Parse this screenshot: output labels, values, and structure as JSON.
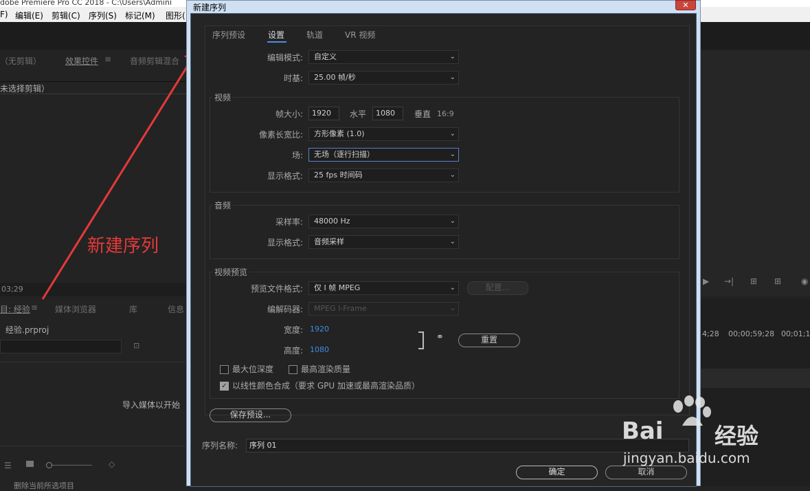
{
  "app": {
    "title": "dobe Premiere Pro CC 2018 - C:\\Users\\Admini",
    "menu": [
      "F)",
      "编辑(E)",
      "剪辑(C)",
      "序列(S)",
      "标记(M)",
      "图形("
    ],
    "left_tabs": [
      "（无剪辑）",
      "效果控件",
      "音频剪辑混合"
    ],
    "no_clip_selected": "未选择剪辑）",
    "timecode": "03;29",
    "project_tabs": [
      "目: 经验",
      "媒体浏览器",
      "库",
      "信息"
    ],
    "project_file": "经验.prproj",
    "import_hint": "导入媒体以开始",
    "delete_hint": "删除当前所选项目",
    "timeline_times": [
      "4;28",
      "00;00;59;28",
      "00;01;14;"
    ]
  },
  "dialog": {
    "title": "新建序列",
    "close_icon": "✕",
    "tabs": [
      {
        "label": "序列预设",
        "active": false
      },
      {
        "label": "设置",
        "active": true
      },
      {
        "label": "轨道",
        "active": false
      },
      {
        "label": "VR 视频",
        "active": false
      }
    ],
    "edit_mode_label": "编辑模式:",
    "edit_mode_value": "自定义",
    "timebase_label": "时基:",
    "timebase_value": "25.00  帧/秒",
    "video": {
      "group_title": "视频",
      "frame_size_label": "帧大小:",
      "width": "1920",
      "horizontal_label": "水平",
      "height": "1080",
      "vertical_label": "垂直",
      "aspect": "16:9",
      "pixel_aspect_label": "像素长宽比:",
      "pixel_aspect_value": "方形像素 (1.0)",
      "field_label": "场:",
      "field_value": "无场（逐行扫描）",
      "display_format_label": "显示格式:",
      "display_format_value": "25 fps 时间码"
    },
    "audio": {
      "group_title": "音频",
      "sample_rate_label": "采样率:",
      "sample_rate_value": "48000 Hz",
      "display_format_label": "显示格式:",
      "display_format_value": "音频采样"
    },
    "preview": {
      "group_title": "视频预览",
      "file_format_label": "预览文件格式:",
      "file_format_value": "仅 I 帧 MPEG",
      "config_button": "配置...",
      "codec_label": "编解码器:",
      "codec_value": "MPEG I-Frame",
      "width_label": "宽度:",
      "width_value": "1920",
      "height_label": "高度:",
      "height_value": "1080",
      "reset_button": "重置",
      "max_bit_depth": "最大位深度",
      "max_render_quality": "最高渲染质量",
      "linear_color": "以线性颜色合成（要求 GPU 加速或最高渲染品质）"
    },
    "save_preset_button": "保存预设...",
    "sequence_name_label": "序列名称:",
    "sequence_name_value": "序列 01",
    "ok_button": "确定",
    "cancel_button": "取消"
  },
  "annotation_text": "新建序列",
  "watermark": {
    "brand": "Bai",
    "brand2": "经验",
    "url": "jingyan.baidu.com"
  },
  "colors": {
    "accent_blue": "#3e8ee0",
    "annotation_red": "#e5393a"
  }
}
